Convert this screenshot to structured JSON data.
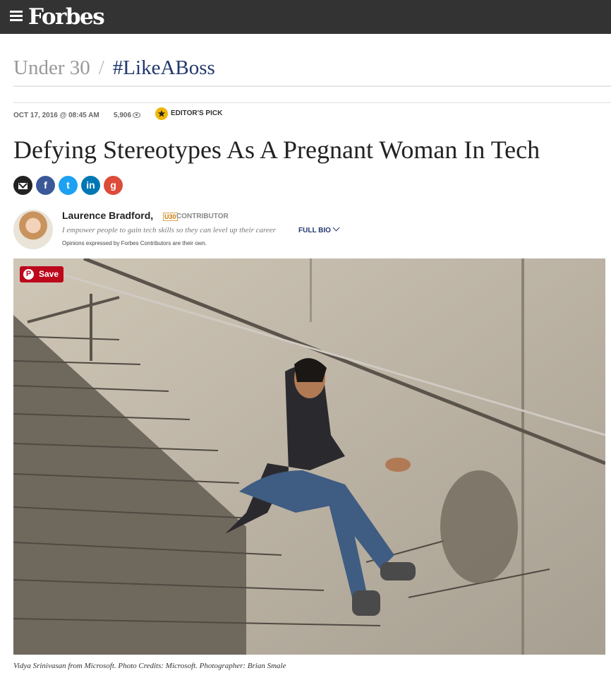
{
  "header": {
    "logo": "Forbes",
    "menu_icon": "hamburger-icon"
  },
  "breadcrumb": {
    "section": "Under 30",
    "separator": "/",
    "tag": "#LikeABoss"
  },
  "meta": {
    "date": "OCT 17, 2016 @ 08:45 AM",
    "views": "5,906",
    "views_icon": "eye-icon",
    "badge_icon": "star-icon",
    "badge": "EDITOR'S PICK"
  },
  "headline": "Defying Stereotypes As A Pregnant Woman In Tech",
  "share": {
    "email_icon": "email-icon",
    "facebook": "f",
    "twitter": "t",
    "linkedin": "in",
    "googleplus": "g"
  },
  "author": {
    "name": "Laurence Bradford,",
    "badge": "U30",
    "role": "CONTRIBUTOR",
    "bio": "I empower people to gain tech skills so they can level up their career",
    "full_bio": "FULL BIO",
    "disclaimer": "Opinions expressed by Forbes Contributors are their own."
  },
  "hero": {
    "save_label": "Save",
    "pin_icon": "P"
  },
  "caption": "Vidya Srinivasan from Microsoft. Photo Credits: Microsoft. Photographer: Brian Smale",
  "colors": {
    "topbar": "#333333",
    "tag": "#21386e",
    "save": "#bd081c",
    "star": "#f1b80a"
  }
}
